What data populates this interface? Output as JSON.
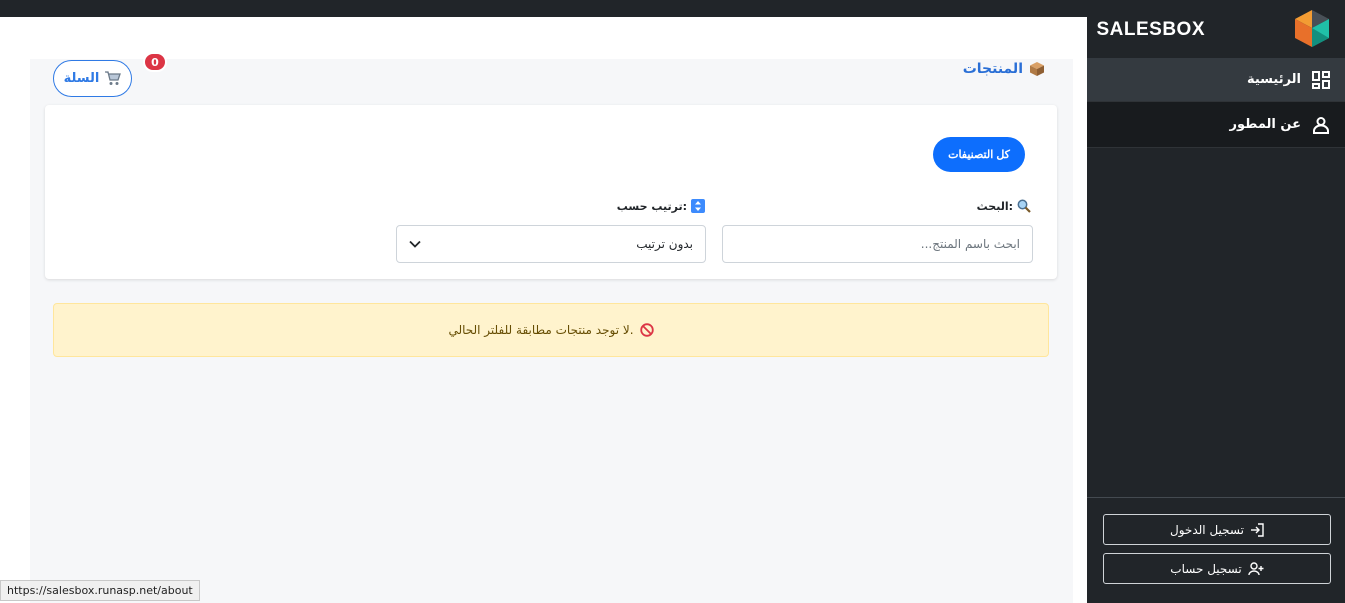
{
  "brand": {
    "name": "SALESBOX"
  },
  "sidebar": {
    "items": [
      {
        "label": "الرئيسية",
        "icon": "dashboard-icon"
      },
      {
        "label": "عن المطور",
        "icon": "person-icon"
      }
    ],
    "login_label": "تسجيل الدخول",
    "register_label": "تسجيل حساب"
  },
  "main": {
    "title": "المنتجات",
    "cart": {
      "label": "السلة",
      "count": "0"
    },
    "categories_button": "كل التصنيفات",
    "search": {
      "label": "البحث:",
      "placeholder": "ابحث باسم المنتج..."
    },
    "sort": {
      "label": "ترتيب حسب:",
      "value": "بدون ترتيب"
    },
    "empty_message": "لا توجد منتجات مطابقة للفلتر الحالي."
  },
  "status_bar": {
    "url": "https://salesbox.runasp.net/about"
  },
  "colors": {
    "sidebar_bg": "#212529",
    "accent": "#0d6efd",
    "danger": "#dc3545",
    "warning_bg": "#fff3cd"
  }
}
